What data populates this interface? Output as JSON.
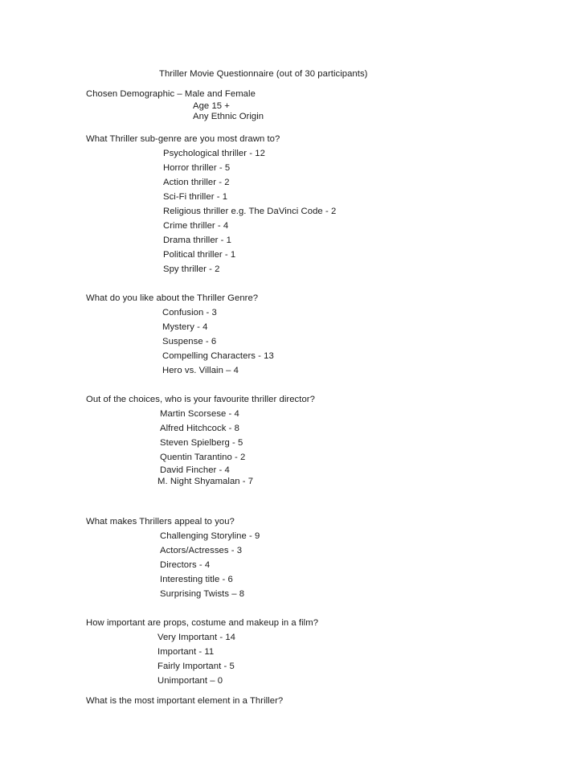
{
  "document": {
    "title": "Thriller Movie Questionnaire (out of 30 participants)",
    "demographic": {
      "heading": "Chosen Demographic – Male and Female",
      "lines": [
        "Age 15 +",
        "Any Ethnic Origin"
      ]
    },
    "sections": [
      {
        "question": "What Thriller sub-genre are you most drawn to?",
        "answers": [
          "Psychological thriller - 12",
          "Horror thriller - 5",
          "Action thriller - 2",
          "Sci-Fi thriller - 1",
          "Religious thriller e.g. The DaVinci Code - 2",
          "Crime thriller - 4",
          "Drama thriller - 1",
          "Political thriller - 1",
          "Spy thriller - 2"
        ]
      },
      {
        "question": "What do you like about the Thriller Genre?",
        "answers": [
          "Confusion - 3",
          "Mystery - 4",
          "Suspense - 6",
          "Compelling Characters - 13",
          "Hero vs. Villain – 4"
        ]
      },
      {
        "question": "Out of the choices, who is your favourite thriller director?",
        "answers": [
          "Martin Scorsese - 4",
          "Alfred Hitchcock - 8",
          "Steven Spielberg - 5",
          "Quentin Tarantino - 2"
        ],
        "answers_tight": [
          "David Fincher - 4",
          "M. Night Shyamalan - 7"
        ]
      },
      {
        "question": "What makes Thrillers appeal to you?",
        "answers": [
          "Challenging Storyline - 9",
          "Actors/Actresses - 3",
          "Directors - 4",
          "Interesting title - 6",
          "Surprising Twists – 8"
        ]
      },
      {
        "question": "How important are props, costume and makeup in a film?",
        "answers": [
          "Very Important - 14",
          "Important - 11",
          "Fairly Important - 5",
          "Unimportant – 0"
        ]
      },
      {
        "question": "What is the most important element in a Thriller?",
        "answers": []
      }
    ]
  }
}
